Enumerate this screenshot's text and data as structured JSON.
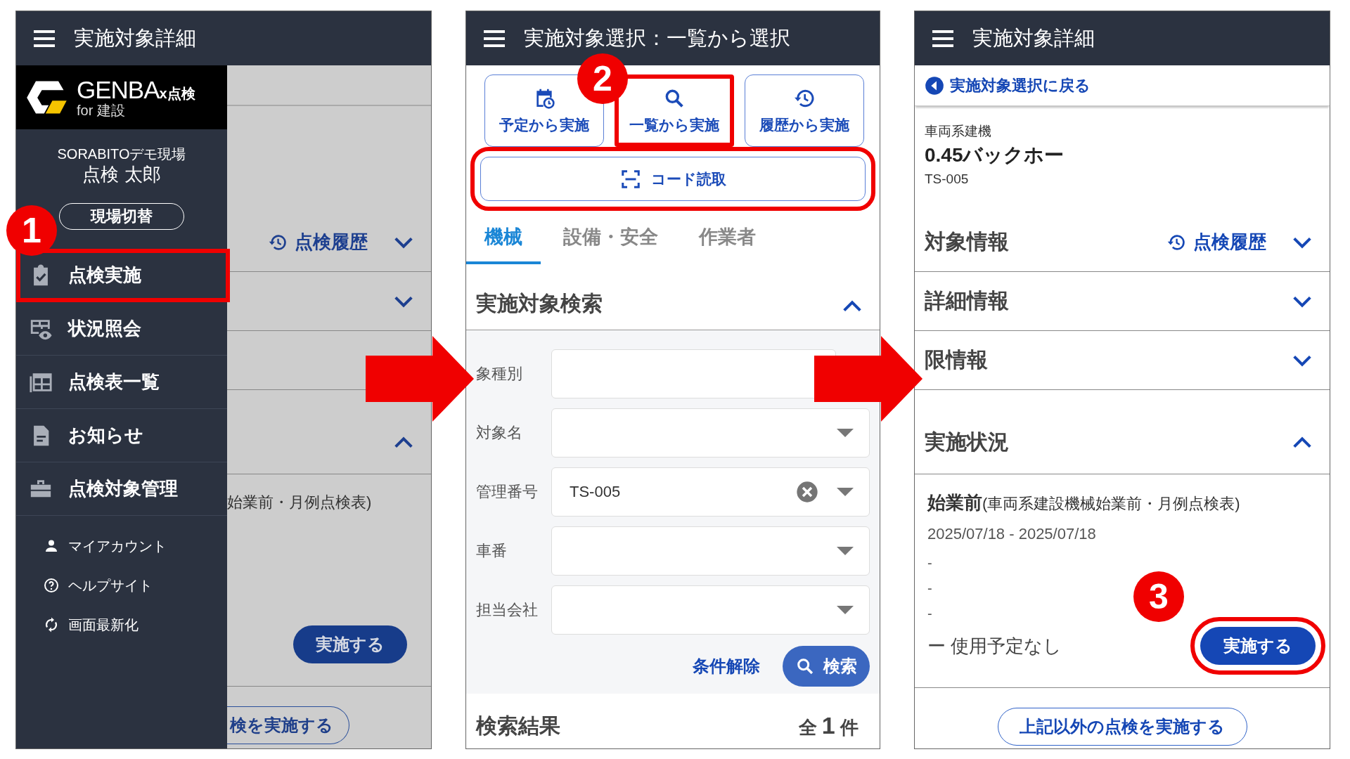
{
  "menu_screen": {
    "title": "実施対象詳細",
    "step": "1",
    "drawer": {
      "logo": {
        "brand": "GENBA",
        "suffix": "x点検",
        "sub": "for 建設"
      },
      "site": "SORABITOデモ現場",
      "user": "点検 太郎",
      "switch_button": "現場切替",
      "items": [
        {
          "label": "点検実施",
          "highlighted": true
        },
        {
          "label": "状況照会",
          "highlighted": false
        },
        {
          "label": "点検表一覧",
          "highlighted": false
        },
        {
          "label": "お知らせ",
          "highlighted": false
        },
        {
          "label": "点検対象管理",
          "highlighted": false
        }
      ],
      "links": [
        {
          "label": "マイアカウント"
        },
        {
          "label": "ヘルプサイト"
        },
        {
          "label": "画面最新化"
        }
      ]
    },
    "background": {
      "sections": [
        {
          "link": "点検履歴",
          "expanded": false
        },
        {
          "expanded": false
        },
        {
          "expanded": true
        }
      ],
      "inspection_text": "始業前・月例点検表)",
      "run_button": "実施する",
      "other_button": "検を実施する"
    }
  },
  "search_screen": {
    "title": "実施対象選択：一覧から選択",
    "step": "2",
    "modes": [
      {
        "label": "予定から実施",
        "highlighted": false
      },
      {
        "label": "一覧から実施",
        "highlighted": true
      },
      {
        "label": "履歴から実施",
        "highlighted": false
      }
    ],
    "scan_button": {
      "label": "コード読取",
      "highlighted": true
    },
    "tabs": [
      {
        "label": "機械",
        "selected": true
      },
      {
        "label": "設備・安全",
        "selected": false
      },
      {
        "label": "作業者",
        "selected": false
      }
    ],
    "search": {
      "title": "実施対象検索",
      "expanded": true,
      "fields": [
        {
          "label": "象種別"
        },
        {
          "label": "対象名"
        },
        {
          "label": "管理番号",
          "value": "TS-005",
          "clearable": true
        },
        {
          "label": "車番"
        },
        {
          "label": "担当会社"
        }
      ],
      "clear_link": "条件解除",
      "search_button": "検索"
    },
    "results": {
      "title": "検索結果",
      "count": "全 **1** 件"
    }
  },
  "detail_screen": {
    "title": "実施対象詳細",
    "step": "3",
    "back_link": "実施対象選択に戻る",
    "category": "車両系建機",
    "name": "0.45バックホー",
    "code": "TS-005",
    "sections": [
      {
        "title": "対象情報",
        "link": "点検履歴",
        "expanded": false
      },
      {
        "title": "詳細情報",
        "expanded": false
      },
      {
        "title": "限情報",
        "expanded": false
      },
      {
        "title": "実施状況",
        "expanded": true
      }
    ],
    "status": {
      "inspection": "**始業前**(車両系建設機械始業前・月例点検表)",
      "period": "2025/07/18 - 2025/07/18",
      "lines": [
        "-",
        "-",
        "-"
      ],
      "usage": "ー 使用予定なし",
      "run_button": {
        "label": "実施する",
        "highlighted": true
      }
    },
    "other_button": "上記以外の点検を実施する"
  }
}
